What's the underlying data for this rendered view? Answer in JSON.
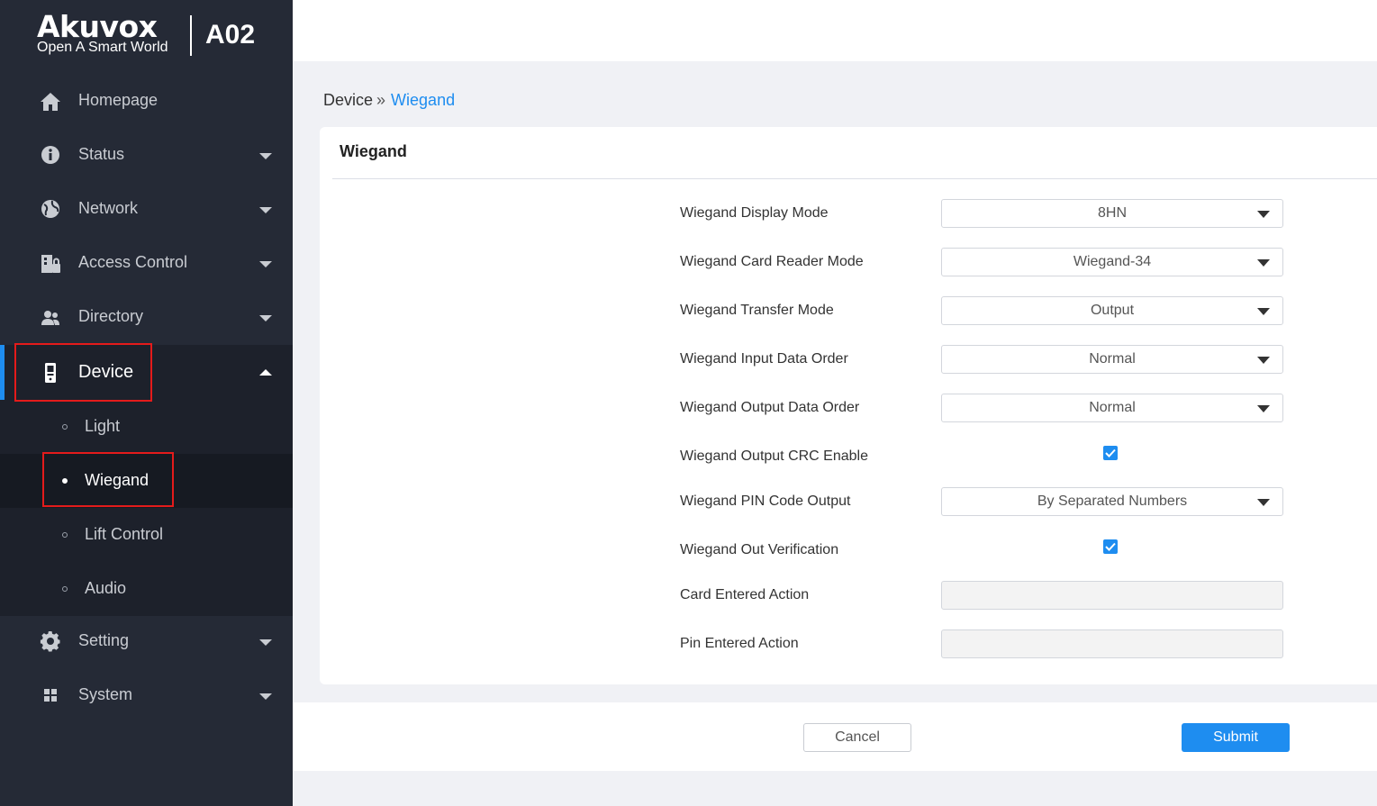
{
  "brand": {
    "name": "Akuvox",
    "tagline": "Open A Smart World",
    "model": "A02"
  },
  "sidebar": {
    "items": [
      {
        "label": "Homepage",
        "icon": "home-icon"
      },
      {
        "label": "Status",
        "icon": "info-icon"
      },
      {
        "label": "Network",
        "icon": "network-globe-icon"
      },
      {
        "label": "Access Control",
        "icon": "access-control-icon"
      },
      {
        "label": "Directory",
        "icon": "contacts-icon"
      },
      {
        "label": "Device",
        "icon": "device-icon"
      },
      {
        "label": "Setting",
        "icon": "gear-icon"
      },
      {
        "label": "System",
        "icon": "system-grid-icon"
      }
    ],
    "device_submenu": [
      {
        "label": "Light"
      },
      {
        "label": "Wiegand"
      },
      {
        "label": "Lift Control"
      },
      {
        "label": "Audio"
      }
    ],
    "active_item": "Device",
    "active_subitem": "Wiegand"
  },
  "breadcrumb": {
    "parent": "Device",
    "separator": "»",
    "current": "Wiegand"
  },
  "card": {
    "title": "Wiegand"
  },
  "form": {
    "display_mode": {
      "label": "Wiegand Display Mode",
      "value": "8HN"
    },
    "card_reader_mode": {
      "label": "Wiegand Card Reader Mode",
      "value": "Wiegand-34"
    },
    "transfer_mode": {
      "label": "Wiegand Transfer Mode",
      "value": "Output"
    },
    "input_data_order": {
      "label": "Wiegand Input Data Order",
      "value": "Normal"
    },
    "output_data_order": {
      "label": "Wiegand Output Data Order",
      "value": "Normal"
    },
    "output_crc_enable": {
      "label": "Wiegand Output CRC Enable",
      "checked": true
    },
    "pin_code_output": {
      "label": "Wiegand PIN Code Output",
      "value": "By Separated Numbers"
    },
    "out_verification": {
      "label": "Wiegand Out Verification",
      "checked": true
    },
    "card_entered_action": {
      "label": "Card Entered Action",
      "value": ""
    },
    "pin_entered_action": {
      "label": "Pin Entered Action",
      "value": ""
    }
  },
  "buttons": {
    "cancel": "Cancel",
    "submit": "Submit"
  },
  "colors": {
    "sidebar_bg": "#252a36",
    "accent": "#1e8df0",
    "highlight_box": "#e41b1b"
  }
}
